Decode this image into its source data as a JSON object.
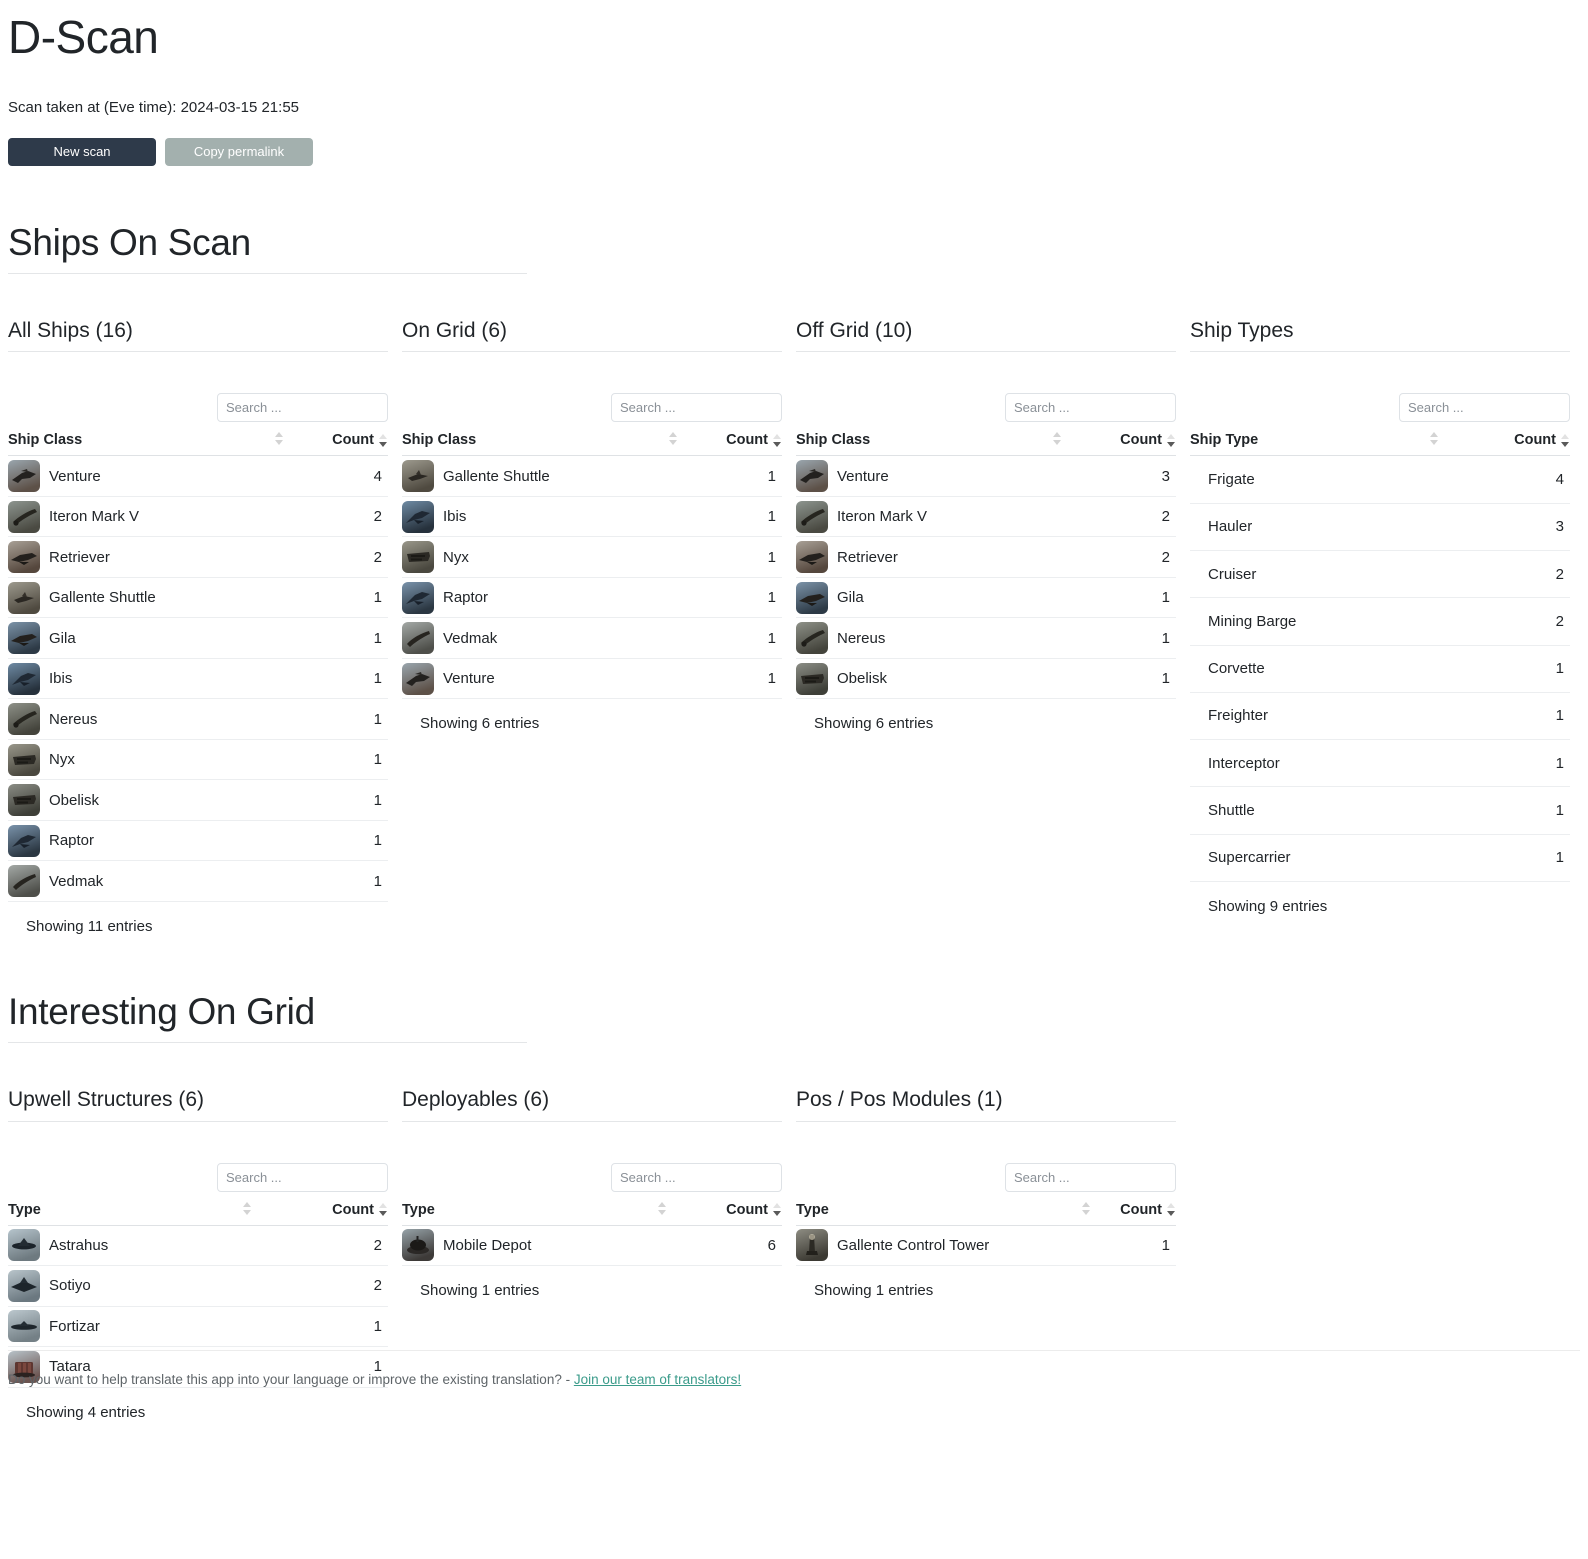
{
  "header": {
    "title": "D-Scan",
    "scan_time_label": "Scan taken at (Eve time): 2024-03-15 21:55",
    "new_scan_label": "New scan",
    "copy_permalink_label": "Copy permalink"
  },
  "colors": {
    "primary_button": "#2e3a4a",
    "muted_button": "#a3b0ae",
    "link": "#3a9b8a",
    "text": "#212529",
    "rule": "#e4e6e8"
  },
  "common": {
    "search_placeholder": "Search ...",
    "count_header": "Count",
    "sort_asc_icon": "sort-ascending-icon",
    "sort_desc_icon": "sort-descending-icon"
  },
  "sections": [
    {
      "id": "ships-on-scan",
      "title": "Ships On Scan",
      "panels": [
        {
          "id": "all-ships",
          "title": "All Ships (16)",
          "name_header": "Ship Class",
          "has_icons": true,
          "rows": [
            {
              "name": "Venture",
              "count": "4",
              "icon": "venture-icon"
            },
            {
              "name": "Iteron Mark V",
              "count": "2",
              "icon": "iteron-mark-v-icon"
            },
            {
              "name": "Retriever",
              "count": "2",
              "icon": "retriever-icon"
            },
            {
              "name": "Gallente Shuttle",
              "count": "1",
              "icon": "gallente-shuttle-icon"
            },
            {
              "name": "Gila",
              "count": "1",
              "icon": "gila-icon"
            },
            {
              "name": "Ibis",
              "count": "1",
              "icon": "ibis-icon"
            },
            {
              "name": "Nereus",
              "count": "1",
              "icon": "nereus-icon"
            },
            {
              "name": "Nyx",
              "count": "1",
              "icon": "nyx-icon"
            },
            {
              "name": "Obelisk",
              "count": "1",
              "icon": "obelisk-icon"
            },
            {
              "name": "Raptor",
              "count": "1",
              "icon": "raptor-icon"
            },
            {
              "name": "Vedmak",
              "count": "1",
              "icon": "vedmak-icon"
            }
          ],
          "showing": "Showing 11 entries"
        },
        {
          "id": "on-grid",
          "title": "On Grid (6)",
          "name_header": "Ship Class",
          "has_icons": true,
          "rows": [
            {
              "name": "Gallente Shuttle",
              "count": "1",
              "icon": "gallente-shuttle-icon"
            },
            {
              "name": "Ibis",
              "count": "1",
              "icon": "ibis-icon"
            },
            {
              "name": "Nyx",
              "count": "1",
              "icon": "nyx-icon"
            },
            {
              "name": "Raptor",
              "count": "1",
              "icon": "raptor-icon"
            },
            {
              "name": "Vedmak",
              "count": "1",
              "icon": "vedmak-icon"
            },
            {
              "name": "Venture",
              "count": "1",
              "icon": "venture-icon"
            }
          ],
          "showing": "Showing 6 entries"
        },
        {
          "id": "off-grid",
          "title": "Off Grid (10)",
          "name_header": "Ship Class",
          "has_icons": true,
          "rows": [
            {
              "name": "Venture",
              "count": "3",
              "icon": "venture-icon"
            },
            {
              "name": "Iteron Mark V",
              "count": "2",
              "icon": "iteron-mark-v-icon"
            },
            {
              "name": "Retriever",
              "count": "2",
              "icon": "retriever-icon"
            },
            {
              "name": "Gila",
              "count": "1",
              "icon": "gila-icon"
            },
            {
              "name": "Nereus",
              "count": "1",
              "icon": "nereus-icon"
            },
            {
              "name": "Obelisk",
              "count": "1",
              "icon": "obelisk-icon"
            }
          ],
          "showing": "Showing 6 entries"
        },
        {
          "id": "ship-types",
          "title": "Ship Types",
          "name_header": "Ship Type",
          "has_icons": false,
          "rows": [
            {
              "name": "Frigate",
              "count": "4"
            },
            {
              "name": "Hauler",
              "count": "3"
            },
            {
              "name": "Cruiser",
              "count": "2"
            },
            {
              "name": "Mining Barge",
              "count": "2"
            },
            {
              "name": "Corvette",
              "count": "1"
            },
            {
              "name": "Freighter",
              "count": "1"
            },
            {
              "name": "Interceptor",
              "count": "1"
            },
            {
              "name": "Shuttle",
              "count": "1"
            },
            {
              "name": "Supercarrier",
              "count": "1"
            }
          ],
          "showing": "Showing 9 entries"
        }
      ]
    },
    {
      "id": "interesting-on-grid",
      "title": "Interesting On Grid",
      "panels": [
        {
          "id": "upwell-structures",
          "title": "Upwell Structures (6)",
          "name_header": "Type",
          "has_icons": true,
          "rows": [
            {
              "name": "Astrahus",
              "count": "2",
              "icon": "astrahus-icon"
            },
            {
              "name": "Sotiyo",
              "count": "2",
              "icon": "sotiyo-icon"
            },
            {
              "name": "Fortizar",
              "count": "1",
              "icon": "fortizar-icon"
            },
            {
              "name": "Tatara",
              "count": "1",
              "icon": "tatara-icon"
            }
          ],
          "showing": "Showing 4 entries"
        },
        {
          "id": "deployables",
          "title": "Deployables (6)",
          "name_header": "Type",
          "has_icons": true,
          "rows": [
            {
              "name": "Mobile Depot",
              "count": "6",
              "icon": "mobile-depot-icon"
            }
          ],
          "showing": "Showing 1 entries"
        },
        {
          "id": "pos-modules",
          "title": "Pos / Pos Modules (1)",
          "name_header": "Type",
          "has_icons": true,
          "rows": [
            {
              "name": "Gallente Control Tower",
              "count": "1",
              "icon": "gallente-control-tower-icon"
            }
          ],
          "showing": "Showing 1 entries"
        }
      ]
    }
  ],
  "footer": {
    "text": "Do you want to help translate this app into your language or improve the existing translation? - ",
    "link_label": "Join our team of translators!"
  }
}
